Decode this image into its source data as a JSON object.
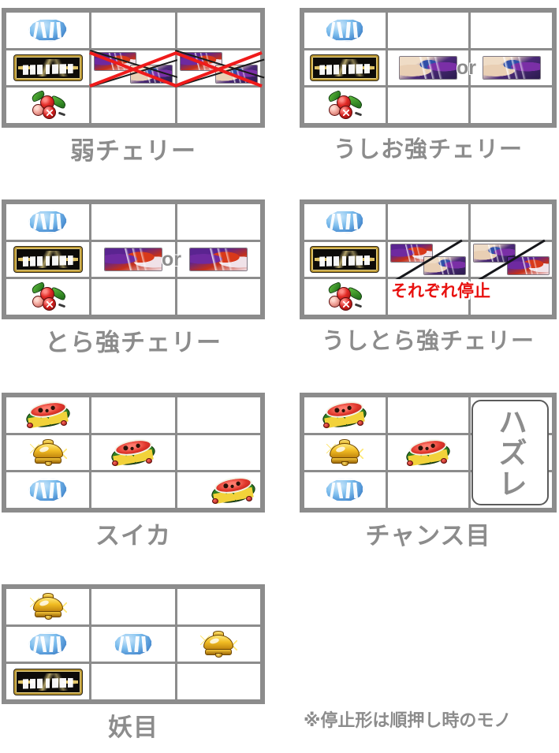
{
  "symbols": {
    "gem": "blue-gem-icon",
    "plate": "ushiotora-title-plate-icon",
    "cherry": "cherry-icon",
    "melon": "watermelon-icon",
    "bell": "gold-bell-icon",
    "ushio": "ushio-beast-icon",
    "tora": "tora-beast-icon"
  },
  "colors": {
    "frame": "#8c8c8c",
    "label": "#8c8c8c",
    "cross_red": "#ef1b1b",
    "slash_black": "#15161a",
    "stop_note_red": "#e8110f",
    "cell_bg": "#ffffff"
  },
  "common": {
    "or_label": "or",
    "miss_label": "ハズレ",
    "stop_note": "それぞれ停止"
  },
  "footnote": "※停止形は順押し時のモノ",
  "panels": [
    {
      "id": "weak-cherry",
      "label": "弱チェリー",
      "reels": [
        [
          "gem",
          "plate",
          "cherry"
        ],
        [
          "",
          "cross-ushio-pair",
          ""
        ],
        [
          "",
          "cross-ushio-pair",
          ""
        ]
      ],
      "notes": []
    },
    {
      "id": "ushio-strong-cherry",
      "label": "うしお強チェリー",
      "reels": [
        [
          "gem",
          "plate",
          "cherry"
        ],
        [
          "",
          "ushio",
          ""
        ],
        [
          "",
          "ushio",
          ""
        ]
      ],
      "notes": [
        "or"
      ]
    },
    {
      "id": "tora-strong-cherry",
      "label": "とら強チェリー",
      "reels": [
        [
          "gem",
          "plate",
          "cherry"
        ],
        [
          "",
          "tora",
          ""
        ],
        [
          "",
          "tora",
          ""
        ]
      ],
      "notes": [
        "or"
      ]
    },
    {
      "id": "ushitora-strong-cherry",
      "label": "うしとら強チェリー",
      "reels": [
        [
          "gem",
          "plate",
          "cherry"
        ],
        [
          "",
          "slash-tora-ushio",
          ""
        ],
        [
          "",
          "slash-ushio-tora",
          ""
        ]
      ],
      "notes": [
        "それぞれ停止"
      ]
    },
    {
      "id": "watermelon",
      "label": "スイカ",
      "reels": [
        [
          "melon",
          "bell",
          "gem"
        ],
        [
          "",
          "melon",
          ""
        ],
        [
          "",
          "",
          "melon"
        ]
      ],
      "notes": []
    },
    {
      "id": "chance-pattern",
      "label": "チャンス目",
      "reels": [
        [
          "melon",
          "bell",
          "gem"
        ],
        [
          "",
          "melon",
          ""
        ],
        [
          "miss",
          "miss",
          "miss"
        ]
      ],
      "notes": [
        "ハズレ"
      ]
    },
    {
      "id": "youme",
      "label": "妖目",
      "reels": [
        [
          "bell",
          "gem",
          "plate"
        ],
        [
          "",
          "gem",
          ""
        ],
        [
          "",
          "bell",
          ""
        ]
      ],
      "notes": []
    }
  ]
}
